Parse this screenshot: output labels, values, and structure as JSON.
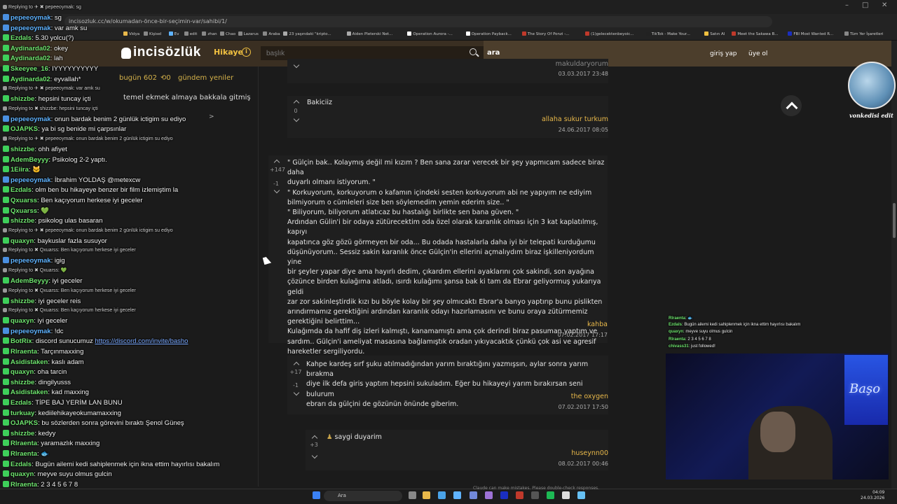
{
  "browser": {
    "url": "incisozluk.cc/w/okumadan-önce-bir-seçimin-var/sahibi/1/",
    "bookmarks": [
      "Vidya",
      "Kişisel",
      "Ev",
      "edit",
      "zhan",
      "Chao",
      "Lazarus",
      "Araba",
      "23 yaşındaki \"kripto...",
      "Aiden Pleterski Net...",
      "Operation Aurora -...",
      "Operation Payback...",
      "The Story Of Ponzi -...",
      "(1)gelecektenbeyoic...",
      "TikTok - Make Your...",
      "Satın Al",
      "Meet the Sakawa B...",
      "FBI Most Wanted R...",
      "Tüm Yer İşaretleri"
    ]
  },
  "site": {
    "logo": "incisözlük",
    "section": "Hikaye",
    "search_placeholder": "başlık",
    "search_button": "ara",
    "login": "giriş yap",
    "signup": "üye ol",
    "today_label": "bugün 602",
    "today_count": "0",
    "gundem": "gündem",
    "yeniler": "yeniler",
    "topic_snippet": "temel ekmek almaya bakkala gitmiş",
    "page_next": ">"
  },
  "entries": [
    {
      "date": "03.03.2017 23:48",
      "author": "makuldaryorum"
    },
    {
      "vote": "0",
      "text": "Bakiciiz",
      "author": "allaha sukur turkum",
      "date": "24.06.2017 08:05"
    },
    {
      "vote_up": "+147",
      "vote_down": "-1",
      "text": [
        "\" Gülçin bak.. Kolaymış değil mi kızım ? Ben sana zarar verecek bir şey yapmıcam sadece biraz daha",
        "duyarlı olmanı istiyorum. \"",
        "\" Korkuyorum, korkuyorum o kafamın içindeki sesten korkuyorum abi ne yapıyım ne ediyim",
        "bilmiyorum o cümleleri size ben söylemedim yemin ederim size.. \"",
        "\" Biliyorum, biliyorum atlatıcaz bu hastalığı birlikte sen bana güven. \"",
        "Ardından Gülin'i bir odaya zütürecektim oda özel olarak karanlık olması için 3 kat kaplatılmış, kapıyı",
        "kapatınca göz gözü görmeyen bir oda... Bu odada hastalarla daha iyi bir telepati kurduğumu",
        "düşünüyorum.. Sessiz sakin karanlık önce Gülçin'in ellerini açmalıydım biraz işkilleniyordum yine",
        "bir şeyler yapar diye ama hayırlı dedim, çıkardım ellerini ayaklarını çok sakindi, son ayağına",
        "çözünce birden kulağıma atladı, ısırdı kulağımı şansa bak ki tam da Ebrar geliyormuş yukarıya geldi",
        "zar zor sakinleştirdik kızı bu böyle kolay bir şey olmıcaktı Ebrar'a banyo yaptırıp bunu pislikten",
        "arındırmamız gerektiğini ardından karanlık odayı hazırlamasını ve bunu oraya zütürmemiz",
        "gerektiğini belirttim...",
        "Kulağımda da hafif diş izleri kalmıştı, kanamamıştı ama çok derindi biraz pasuman yaptım ve",
        "sardım.. Gülçin'i ameliyat masasına bağlamıştık oradan yıkıyacaktık çünkü çok asi ve agresif",
        "hareketler sergiliyordu."
      ],
      "author": "kahba",
      "date": "07.02.2017 17:17"
    },
    {
      "vote_up": "+17",
      "vote_down": "-1",
      "text": [
        "Kahpe kardeş sırf şuku atılmadığından yarım bıraktığını yazmışsın, aylar sonra yarım bırakma",
        "diye ilk defa giris yaptım hepsini sukuladım. Eğer bu hikayeyi yarım bırakırsan seni bulurum",
        "ebrarı da gülçini de gözünün önünde giberim."
      ],
      "author": "the oxygen",
      "date": "07.02.2017 17:50"
    },
    {
      "vote_up": "+3",
      "text": "saygi duyarim",
      "author": "huseynn00",
      "date": "08.02.2017 00:46"
    }
  ],
  "chat": [
    {
      "type": "reply",
      "text": "Replying to ✈ ✖ pepeeoymak: sg"
    },
    {
      "user": "pepeeoymak",
      "color": "#5fb3ff",
      "msg": "sg"
    },
    {
      "user": "pepeeoymak",
      "color": "#5fb3ff",
      "msg": "var amk su"
    },
    {
      "user": "Ezdals",
      "color": "#6fe56f",
      "msg": "5.30 yolcu(?)"
    },
    {
      "user": "Aydinarda02",
      "color": "#6fe56f",
      "msg": "okey"
    },
    {
      "user": "Aydinarda02",
      "color": "#6fe56f",
      "msg": "lah"
    },
    {
      "user": "Skeeyee_16",
      "color": "#6fe56f",
      "msg": "IYYYYYYYYYY"
    },
    {
      "user": "Aydinarda02",
      "color": "#6fe56f",
      "msg": "eyvallah*"
    },
    {
      "type": "reply",
      "text": "Replying to ✈ ✖ pepeeoymak: var amk su"
    },
    {
      "user": "shizzbe",
      "color": "#6fe56f",
      "msg": "hepsini tuncay içti"
    },
    {
      "type": "reply",
      "text": "Replying to ✖ shizzbe: hepsini tuncay içti"
    },
    {
      "user": "pepeeoymak",
      "color": "#5fb3ff",
      "msg": "onun bardak benim 2 günlük ictigim su ediyo"
    },
    {
      "user": "OJAPKS",
      "color": "#6fe56f",
      "msg": "ya bi sg benide mi çarpsınlar"
    },
    {
      "type": "reply",
      "text": "Replying to ✈ ✖ pepeeoymak: onun bardak benim 2 günlük ictigim su ediyo"
    },
    {
      "user": "shizzbe",
      "color": "#6fe56f",
      "msg": "ohh afiyet"
    },
    {
      "user": "AdemBeyyy",
      "color": "#6fe56f",
      "msg": "Psikolog 2-2 yaptı."
    },
    {
      "user": "1Eiira",
      "color": "#6fe56f",
      "msg": "🐱"
    },
    {
      "user": "pepeeoymak",
      "color": "#5fb3ff",
      "msg": "İbrahim YOLDAŞ @metexcw"
    },
    {
      "user": "Ezdals",
      "color": "#6fe56f",
      "msg": "olm ben bu hikayeye benzer bir film izlemiştim la"
    },
    {
      "user": "Qxuarss",
      "color": "#6fe56f",
      "msg": "Ben kaçıyorum herkese iyi geceler"
    },
    {
      "user": "Qxuarss",
      "color": "#6fe56f",
      "msg": "💚"
    },
    {
      "user": "shizzbe",
      "color": "#6fe56f",
      "msg": "psikolog ulas basaran"
    },
    {
      "type": "reply",
      "text": "Replying to ✈ ✖ pepeeoymak: onun bardak benim 2 günlük ictigim su ediyo"
    },
    {
      "user": "quaxyn",
      "color": "#6fe56f",
      "msg": "baykuslar fazla susuyor"
    },
    {
      "type": "reply",
      "text": "Replying to ✖ Qxuarss: Ben kaçıyorum herkese iyi geceler"
    },
    {
      "user": "pepeeoymak",
      "color": "#5fb3ff",
      "msg": "igig"
    },
    {
      "type": "reply",
      "text": "Replying to ✖ Qxuarss: 💚"
    },
    {
      "user": "AdemBeyyy",
      "color": "#6fe56f",
      "msg": "iyi geceler"
    },
    {
      "type": "reply",
      "text": "Replying to ✖ Qxuarss: Ben kaçıyorum herkese iyi geceler"
    },
    {
      "user": "shizzbe",
      "color": "#6fe56f",
      "msg": "iyi geceler reis"
    },
    {
      "type": "reply",
      "text": "Replying to ✖ Qxuarss: Ben kaçıyorum herkese iyi geceler"
    },
    {
      "user": "quaxyn",
      "color": "#6fe56f",
      "msg": "iyi geceler"
    },
    {
      "user": "pepeeoymak",
      "color": "#5fb3ff",
      "msg": "!dc"
    },
    {
      "user": "BotRix",
      "color": "#6fe56f",
      "msg": "discord sunucumuz ",
      "link": "https://discord.com/invite/basho"
    },
    {
      "user": "Rlraenta",
      "color": "#6fe56f",
      "msg": "Tarçınmaxxing"
    },
    {
      "user": "Asidistaken",
      "color": "#6fe56f",
      "msg": "kaslı adam"
    },
    {
      "user": "quaxyn",
      "color": "#6fe56f",
      "msg": "oha tarcin"
    },
    {
      "user": "shizzbe",
      "color": "#6fe56f",
      "msg": "dingilyusss"
    },
    {
      "user": "Asidistaken",
      "color": "#6fe56f",
      "msg": "kad maxxing"
    },
    {
      "user": "Ezdals",
      "color": "#6fe56f",
      "msg": "TİPE BAJ YERİM LAN BUNU"
    },
    {
      "user": "turkuay",
      "color": "#6fe56f",
      "msg": "kediilehikayeokumamaxxing"
    },
    {
      "user": "OJAPKS",
      "color": "#6fe56f",
      "msg": "bu sözlerden sonra görevini bıraktı Şenol Güneş"
    },
    {
      "user": "shizzbe",
      "color": "#6fe56f",
      "msg": "kedyy"
    },
    {
      "user": "Rlraenta",
      "color": "#6fe56f",
      "msg": "yaramazlık maxxing"
    },
    {
      "user": "Rlraenta",
      "color": "#6fe56f",
      "msg": "🐟"
    },
    {
      "user": "Ezdals",
      "color": "#6fe56f",
      "msg": "Bugün ailemi kedi sahiplenmek için ikna ettim hayırlısı bakalım"
    },
    {
      "user": "quaxyn",
      "color": "#6fe56f",
      "msg": "meyve suyu olmus gulcin"
    },
    {
      "user": "Rlraenta",
      "color": "#6fe56f",
      "msg": "2 3 4 5 6 7 8"
    },
    {
      "user": "chivass31",
      "color": "#ffffff",
      "msg": "just followed!"
    }
  ],
  "mini_chat": [
    {
      "user": "Rlraenta",
      "msg": "🐟"
    },
    {
      "user": "Ezdals",
      "msg": "Bugün ailemi kedi sahiplenmek için ikna ettim hayırlısı bakalım"
    },
    {
      "user": "quaxyn",
      "msg": "meyve suyu olmus gulcin"
    },
    {
      "user": "Rlraenta",
      "msg": "2 3 4 5 6 7 8"
    },
    {
      "user": "chivass31",
      "msg": "just followed!"
    }
  ],
  "stream": {
    "avatar_caption": "vonkedisi edit",
    "neon_sign": "Başo"
  },
  "taskbar": {
    "search": "Ara",
    "time": "04:09",
    "date": "24.03.2026",
    "notice": "Claude can make mistakes. Please double-check responses."
  }
}
